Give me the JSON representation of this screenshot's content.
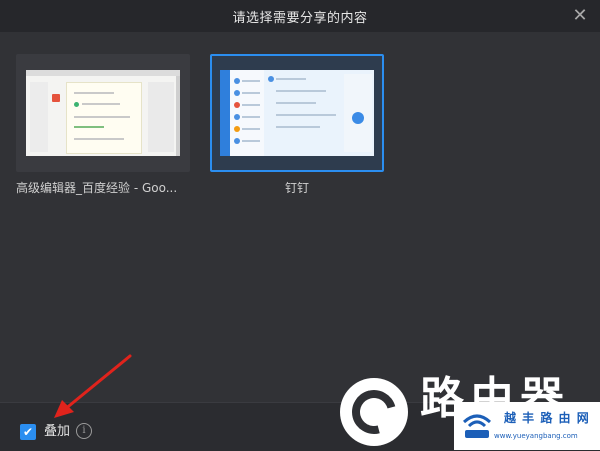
{
  "dialog": {
    "title": "请选择需要分享的内容",
    "close_symbol": "✕"
  },
  "windows": [
    {
      "label": "高级编辑器_百度经验 - Goo...",
      "selected": false,
      "kind": "browser"
    },
    {
      "label": "钉钉",
      "selected": true,
      "kind": "dingtalk"
    }
  ],
  "footer": {
    "overlay_checkbox": {
      "checked": true,
      "label": "叠加",
      "check_symbol": "✔"
    },
    "info_symbol": "i"
  },
  "watermark": {
    "text": "路由器",
    "site_title": "越 丰 路 由 网",
    "site_url": "www.yueyangbang.com"
  },
  "colors": {
    "accent": "#2b8ef0",
    "annotation_arrow": "#e0231c"
  }
}
